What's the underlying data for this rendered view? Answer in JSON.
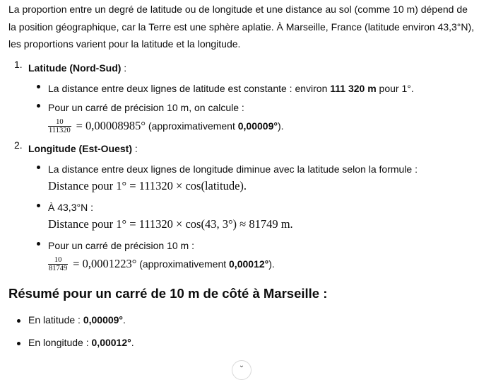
{
  "intro": "La proportion entre un degré de latitude ou de longitude et une distance au sol (comme 10 m) dépend de la position géographique, car la Terre est une sphère aplatie. À Marseille, France (latitude environ 43,3°N), les proportions varient pour la latitude et la longitude.",
  "sections": [
    {
      "number": "1.",
      "title": "Latitude (Nord-Sud)",
      "title_suffix": " :",
      "items": [
        {
          "pre": "La distance entre deux lignes de latitude est constante : environ ",
          "bold": "111 320 m",
          "post": " pour 1°."
        },
        {
          "text": "Pour un carré de précision 10 m, on calcule :",
          "frac_num": "10",
          "frac_den": "111320",
          "math": "= 0,00008985°",
          "approx_pre": "(approximativement ",
          "approx_bold": "0,00009°",
          "approx_post": ")."
        }
      ]
    },
    {
      "number": "2.",
      "title": "Longitude (Est-Ouest)",
      "title_suffix": " :",
      "items": [
        {
          "text": "La distance entre deux lignes de longitude diminue avec la latitude selon la formule :",
          "math": "Distance pour 1° = 111320 × cos(latitude)."
        },
        {
          "text": "À 43,3°N :",
          "math": "Distance pour 1° = 111320 × cos(43, 3°) ≈ 81749 m."
        },
        {
          "text": "Pour un carré de précision 10 m :",
          "frac_num": "10",
          "frac_den": "81749",
          "math": "= 0,0001223°",
          "approx_pre": "(approximativement ",
          "approx_bold": "0,00012°",
          "approx_post": ")."
        }
      ]
    }
  ],
  "summary": {
    "title": "Résumé pour un carré de 10 m de côté à Marseille :",
    "items": [
      {
        "pre": "En latitude : ",
        "bold": "0,00009°",
        "post": "."
      },
      {
        "pre": "En longitude : ",
        "bold": "0,00012°",
        "post": "."
      }
    ]
  },
  "scroll_icon": "chevron-down-icon"
}
